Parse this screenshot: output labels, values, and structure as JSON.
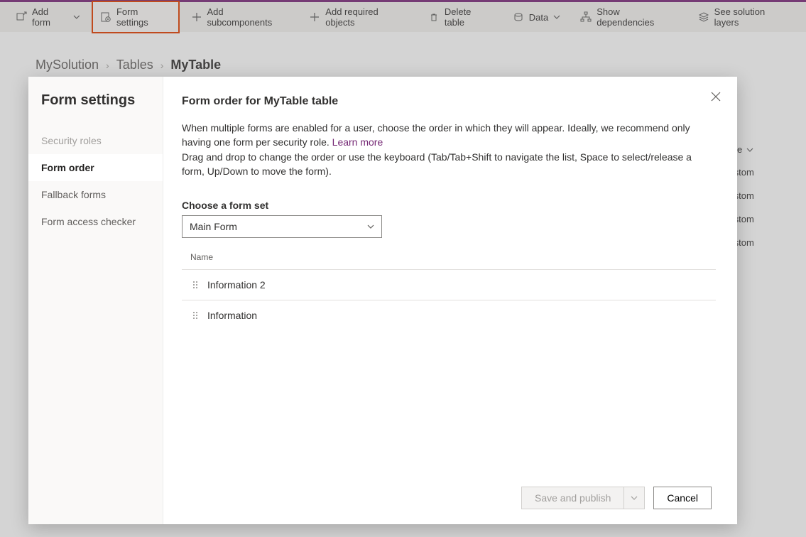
{
  "cmdbar": {
    "add_form": "Add form",
    "form_settings": "Form settings",
    "add_subcomponents": "Add subcomponents",
    "add_required": "Add required objects",
    "delete_table": "Delete table",
    "data": "Data",
    "show_deps": "Show dependencies",
    "solution_layers": "See solution layers"
  },
  "breadcrumb": {
    "root": "MySolution",
    "level1": "Tables",
    "current": "MyTable"
  },
  "bg_table": {
    "type_header": "Type",
    "rows": [
      "Custom",
      "Custom",
      "Custom",
      "Custom"
    ]
  },
  "dialog": {
    "left_title": "Form settings",
    "nav": {
      "security": "Security roles",
      "form_order": "Form order",
      "fallback": "Fallback forms",
      "access_checker": "Form access checker"
    },
    "heading": "Form order for MyTable table",
    "desc1": "When multiple forms are enabled for a user, choose the order in which they will appear. Ideally, we recommend only having one form per security role.",
    "learn_more": "Learn more",
    "desc2": "Drag and drop to change the order or use the keyboard (Tab/Tab+Shift to navigate the list, Space to select/release a form, Up/Down to move the form).",
    "formset_label": "Choose a form set",
    "formset_value": "Main Form",
    "list_header": "Name",
    "rows": [
      "Information 2",
      "Information"
    ],
    "save": "Save and publish",
    "cancel": "Cancel"
  }
}
